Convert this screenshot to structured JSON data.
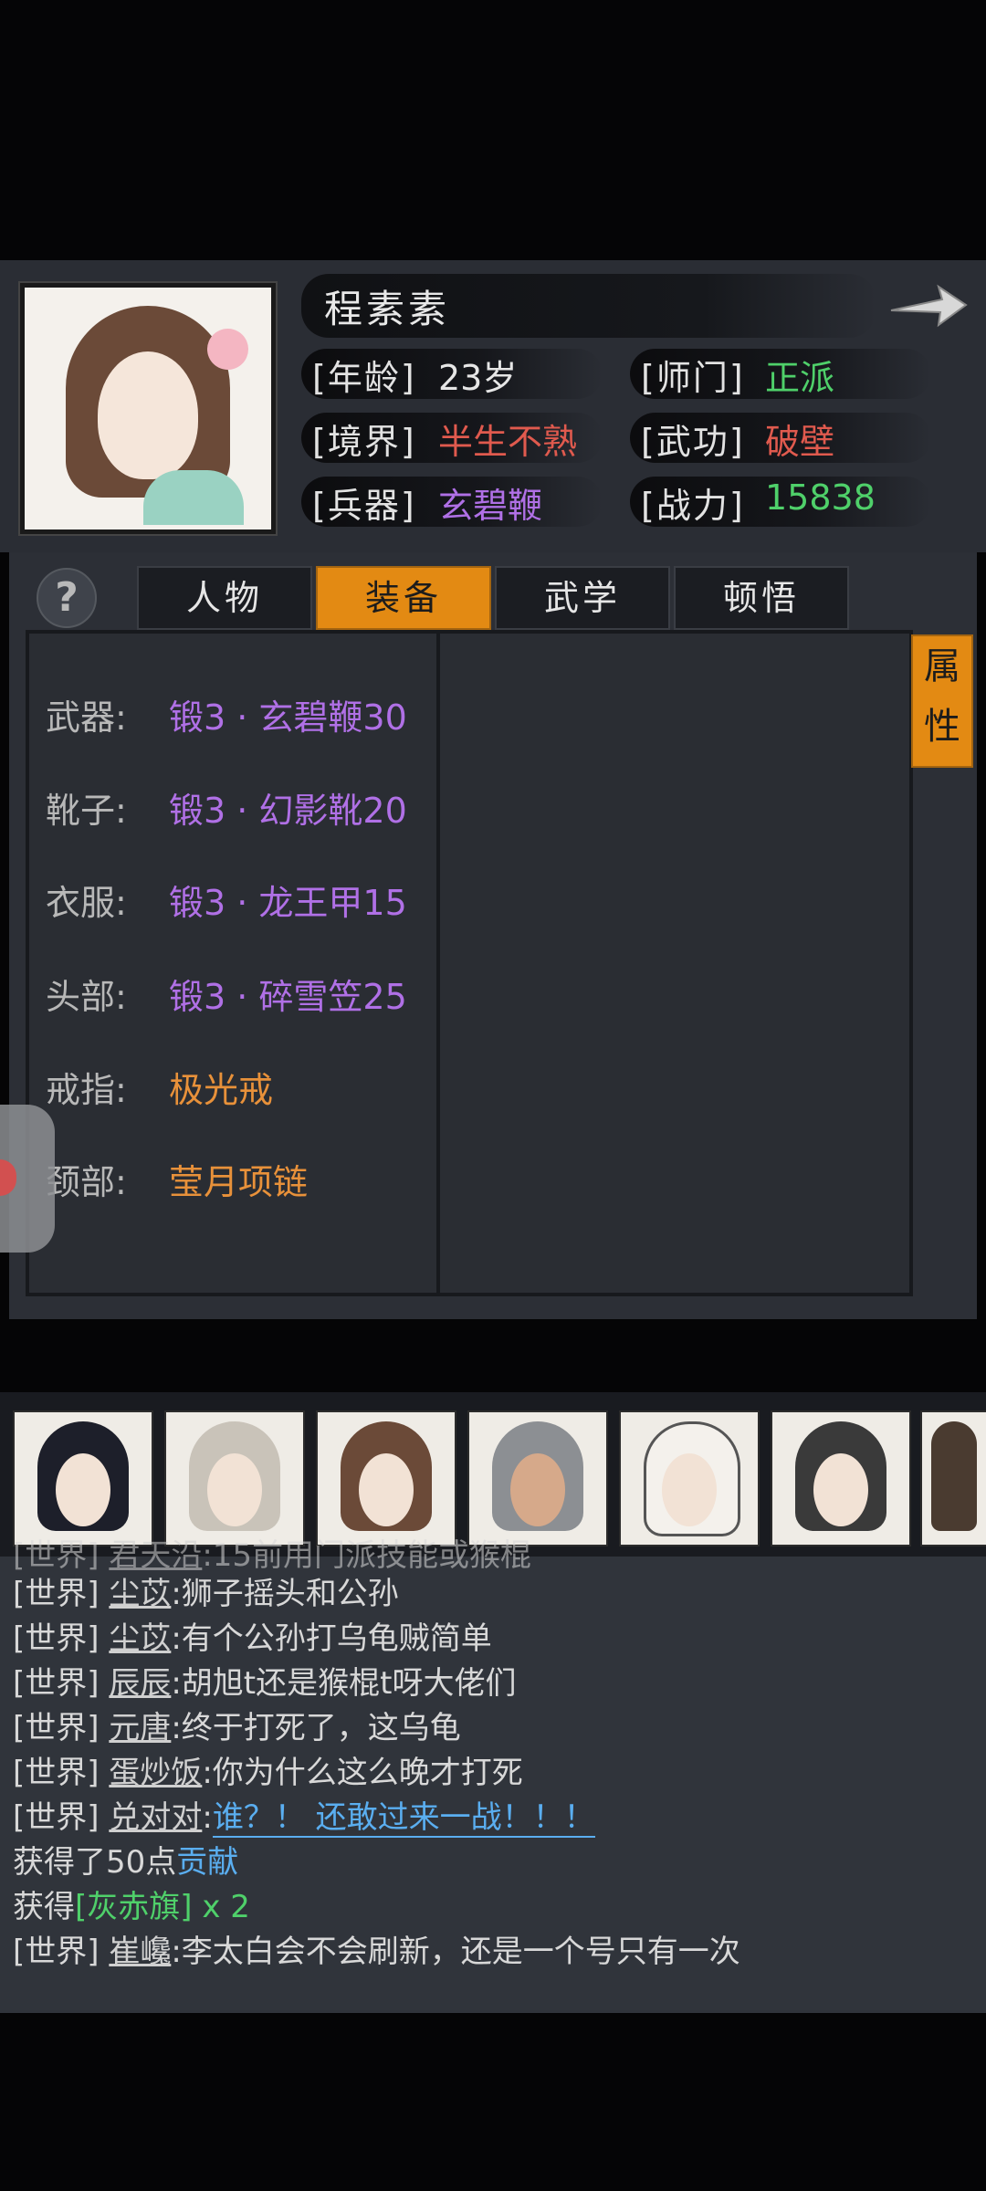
{
  "hero": {
    "name": "程素素",
    "age_label": "[年龄]",
    "age_value": "23岁",
    "sect_label": "[师门]",
    "sect_value": "正派",
    "realm_label": "[境界]",
    "realm_value": "半生不熟",
    "martial_label": "[武功]",
    "martial_value": "破壁",
    "weapon_label": "[兵器]",
    "weapon_value": "玄碧鞭",
    "power_label": "[战力]",
    "power_value": "15838"
  },
  "tabs": [
    {
      "label": "人物"
    },
    {
      "label": "装备"
    },
    {
      "label": "武学"
    },
    {
      "label": "顿悟"
    }
  ],
  "side_tab": {
    "label_1": "属",
    "label_2": "性"
  },
  "help_icon": "?",
  "equipment": [
    {
      "label": "武器:",
      "value": "锻3 · 玄碧鞭30",
      "color": "#b070e6"
    },
    {
      "label": "靴子:",
      "value": "锻3 · 幻影靴20",
      "color": "#b070e6"
    },
    {
      "label": "衣服:",
      "value": "锻3 · 龙王甲15",
      "color": "#b070e6"
    },
    {
      "label": "头部:",
      "value": "锻3 · 碎雪笠25",
      "color": "#b070e6"
    },
    {
      "label": "戒指:",
      "value": "极光戒",
      "color": "#e8913a"
    },
    {
      "label": "颈部:",
      "value": "莹月项链",
      "color": "#e8913a"
    }
  ],
  "chat": [
    {
      "prefix": "[世界]",
      "name": "君天沿",
      "text": ":15前用门派技能或猴棍"
    },
    {
      "prefix": "[世界]",
      "name": "尘苡",
      "text": ":狮子摇头和公孙"
    },
    {
      "prefix": "[世界]",
      "name": "尘苡",
      "text": ":有个公孙打乌龟贼简单"
    },
    {
      "prefix": "[世界]",
      "name": "辰辰",
      "text": ":胡旭t还是猴棍t呀大佬们"
    },
    {
      "prefix": "[世界]",
      "name": "元唐",
      "text": ":终于打死了，这乌龟"
    },
    {
      "prefix": "[世界]",
      "name": "蛋炒饭",
      "text": ":你为什么这么晚才打死"
    },
    {
      "prefix": "[世界]",
      "name": "兑对对",
      "text": ":",
      "highlight": "谁？！ 还敢过来一战！！！"
    },
    {
      "text": "获得了50点",
      "highlight": "贡献"
    },
    {
      "text": "获得",
      "item": "[灰赤旗]",
      "suffix": " x 2"
    },
    {
      "prefix": "[世界]",
      "name": "崔巉",
      "text": ":李太白会不会刷新，还是一个号只有一次"
    }
  ],
  "colors": {
    "accent_orange": "#e38a13",
    "value_red": "#e05a4e",
    "value_purple": "#b070e6",
    "value_green": "#4fd06a",
    "value_orange": "#e8913a",
    "chat_blue": "#5aaef0"
  }
}
